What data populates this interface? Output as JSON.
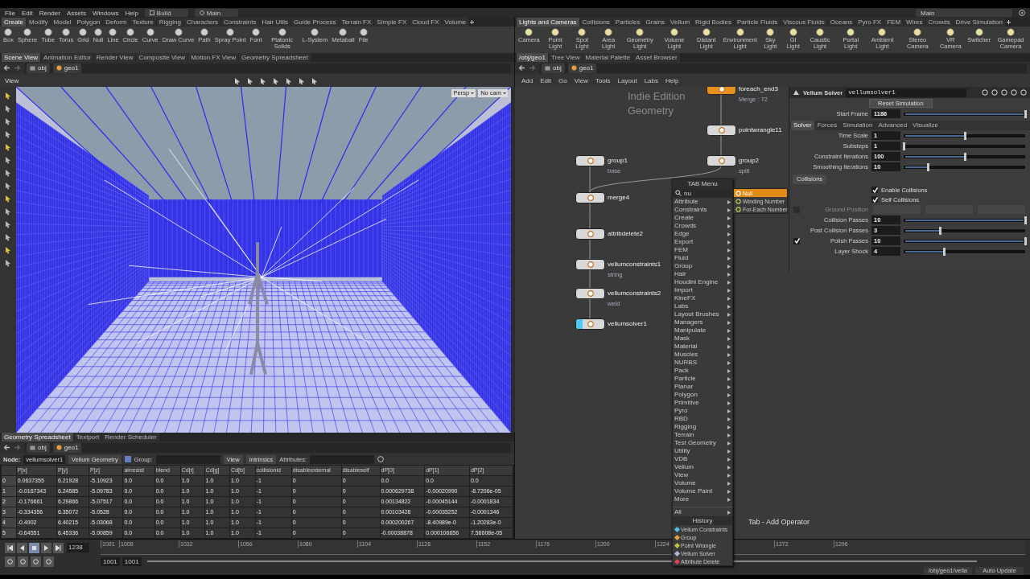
{
  "menubar": {
    "items": [
      "File",
      "Edit",
      "Render",
      "Assets",
      "Windows",
      "Help"
    ],
    "desktop": "Build",
    "context": "Main",
    "right_desktop": "Main"
  },
  "shelf_left": {
    "tabs": [
      {
        "label": "Create",
        "selected": true
      },
      {
        "label": "Modify",
        "selected": false
      },
      {
        "label": "Model",
        "selected": false
      },
      {
        "label": "Polygon",
        "selected": false
      },
      {
        "label": "Deform",
        "selected": false
      },
      {
        "label": "Texture",
        "selected": false
      },
      {
        "label": "Rigging",
        "selected": false
      },
      {
        "label": "Characters",
        "selected": false
      },
      {
        "label": "Constraints",
        "selected": false
      },
      {
        "label": "Hair Utils",
        "selected": false
      },
      {
        "label": "Guide Process",
        "selected": false
      },
      {
        "label": "Terrain FX",
        "selected": false
      },
      {
        "label": "Simple FX",
        "selected": false
      },
      {
        "label": "Cloud FX",
        "selected": false
      },
      {
        "label": "Volume",
        "selected": false
      }
    ],
    "tools": [
      "Box",
      "Sphere",
      "Tube",
      "Torus",
      "Grid",
      "Null",
      "Line",
      "Circle",
      "Curve",
      "Draw Curve",
      "Path",
      "Spray Point",
      "Font",
      "Platonic Solids",
      "L-System",
      "Metaball",
      "File"
    ]
  },
  "shelf_right": {
    "tabs": [
      {
        "label": "Lights and Cameras",
        "selected": true
      },
      {
        "label": "Collisions",
        "selected": false
      },
      {
        "label": "Particles",
        "selected": false
      },
      {
        "label": "Grains",
        "selected": false
      },
      {
        "label": "Vellum",
        "selected": false
      },
      {
        "label": "Rigid Bodies",
        "selected": false
      },
      {
        "label": "Particle Fluids",
        "selected": false
      },
      {
        "label": "Viscous Fluids",
        "selected": false
      },
      {
        "label": "Oceans",
        "selected": false
      },
      {
        "label": "Pyro FX",
        "selected": false
      },
      {
        "label": "FEM",
        "selected": false
      },
      {
        "label": "Wires",
        "selected": false
      },
      {
        "label": "Crowds",
        "selected": false
      },
      {
        "label": "Drive Simulation",
        "selected": false
      }
    ],
    "tools": [
      "Camera",
      "Point Light",
      "Spot Light",
      "Area Light",
      "Geometry Light",
      "Volume Light",
      "Distant Light",
      "Environment Light",
      "Sky Light",
      "GI Light",
      "Caustic Light",
      "Portal Light",
      "Ambient Light",
      "Stereo Camera",
      "VR Camera",
      "Switcher",
      "Gamepad Camera"
    ]
  },
  "left_pane": {
    "tabs": [
      {
        "label": "Scene View",
        "selected": true
      },
      {
        "label": "Animation Editor",
        "selected": false
      },
      {
        "label": "Render View",
        "selected": false
      },
      {
        "label": "Composite View",
        "selected": false
      },
      {
        "label": "Motion FX View",
        "selected": false
      },
      {
        "label": "Geometry Spreadsheet",
        "selected": false
      }
    ],
    "path": [
      "obj",
      "geo1"
    ],
    "view_label": "View",
    "camera": "Persp",
    "cam_menu": "No cam"
  },
  "spreadsheet": {
    "tabs": [
      {
        "label": "Geometry Spreadsheet",
        "selected": true
      },
      {
        "label": "Textport",
        "selected": false
      },
      {
        "label": "Render Scheduler",
        "selected": false
      }
    ],
    "path": [
      "obj",
      "geo1"
    ],
    "node_label": "Node:",
    "node": "vellumsolver1",
    "geometry_menu": "Vellum Geometry",
    "group_label": "Group:",
    "view_menu": "View",
    "intrinsics": "Intrinsics",
    "attributes_label": "Attributes:",
    "columns": [
      "",
      "P[x]",
      "P[y]",
      "P[z]",
      "airresist",
      "blend",
      "Cd[r]",
      "Cd[g]",
      "Cd[b]",
      "collisionid",
      "disableexternal",
      "disableself",
      "dP[0]",
      "dP[1]",
      "dP[2]"
    ],
    "rows": [
      [
        "0",
        "0.0637355",
        "6.21928",
        "-5.10923",
        "0.0",
        "0.0",
        "1.0",
        "1.0",
        "1.0",
        "-1",
        "0",
        "0",
        "0.0",
        "0.0",
        "0.0"
      ],
      [
        "1",
        "-0.0167343",
        "6.24585",
        "-5.09783",
        "0.0",
        "0.0",
        "1.0",
        "1.0",
        "1.0",
        "-1",
        "0",
        "0",
        "0.000629738",
        "-0.00020990",
        "-8.7206e-05"
      ],
      [
        "2",
        "-0.176661",
        "6.29866",
        "-5.07517",
        "0.0",
        "0.0",
        "1.0",
        "1.0",
        "1.0",
        "-1",
        "0",
        "0",
        "0.00134822",
        "-0.00045144",
        "-0.0001834"
      ],
      [
        "3",
        "-0.334356",
        "6.35072",
        "-5.0528",
        "0.0",
        "0.0",
        "1.0",
        "1.0",
        "1.0",
        "-1",
        "0",
        "0",
        "0.00103428",
        "-0.00035252",
        "-0.0001346"
      ],
      [
        "4",
        "-0.4902",
        "6.40215",
        "-5.03068",
        "0.0",
        "0.0",
        "1.0",
        "1.0",
        "1.0",
        "-1",
        "0",
        "0",
        "0.000200267",
        "-8.40989e-0",
        "-1.20283e-0"
      ],
      [
        "5",
        "-0.64551",
        "6.45336",
        "-5.00859",
        "0.0",
        "0.0",
        "1.0",
        "1.0",
        "1.0",
        "-1",
        "0",
        "0",
        "-0.00038878",
        "0.000106656",
        "7.56608e-05"
      ]
    ]
  },
  "right_pane": {
    "tabs": [
      {
        "label": "/obj/geo1",
        "selected": true
      },
      {
        "label": "Tree View",
        "selected": false
      },
      {
        "label": "Material Palette",
        "selected": false
      },
      {
        "label": "Asset Browser",
        "selected": false
      }
    ],
    "path": [
      "obj",
      "geo1"
    ],
    "menu": [
      "Add",
      "Edit",
      "Go",
      "View",
      "Tools",
      "Layout",
      "Labs",
      "Help"
    ],
    "network": {
      "edition_label": "Indie Edition",
      "context_label": "Geometry",
      "hint": "Tab - Add Operator",
      "nodes": [
        {
          "name": "foreach_end3",
          "comment": "Merge : 72",
          "color": "#e8901e",
          "display": false
        },
        {
          "name": "pointwrangle11",
          "color": "#d8d8d8",
          "display": false
        },
        {
          "name": "group1",
          "comment": "base",
          "color": "#d8d8d8",
          "display": false
        },
        {
          "name": "group2",
          "comment": "split",
          "color": "#d8d8d8",
          "display": false
        },
        {
          "name": "merge4",
          "color": "#d8d8d8",
          "display": false
        },
        {
          "name": "attribdelete2",
          "color": "#d8d8d8",
          "display": false
        },
        {
          "name": "vellumconstraints1",
          "comment": "string",
          "color": "#d8d8d8",
          "display": false
        },
        {
          "name": "vellumconstraints2",
          "comment": "weld",
          "color": "#d8d8d8",
          "display": false
        },
        {
          "name": "vellumsolver1",
          "color": "#d8d8d8",
          "display": true
        }
      ]
    },
    "parameters": {
      "type_label": "Vellum Solver",
      "node_name": "vellumsolver1",
      "reset_button": "Reset Simulation",
      "start_frame": {
        "label": "Start Frame",
        "value": "1186",
        "level": 1
      },
      "tabs": [
        {
          "label": "Solver",
          "selected": true
        },
        {
          "label": "Forces",
          "selected": false
        },
        {
          "label": "Simulation",
          "selected": false
        },
        {
          "label": "Advanced",
          "selected": false
        },
        {
          "label": "Visualize",
          "selected": false
        }
      ],
      "solver_rows": [
        {
          "label": "Time Scale",
          "value": "1",
          "level": 0.5
        },
        {
          "label": "Substeps",
          "value": "1",
          "level": 0
        },
        {
          "label": "Constraint Iterations",
          "value": "100",
          "level": 0.5
        },
        {
          "label": "Smoothing Iterations",
          "value": "10",
          "level": 0.2
        }
      ],
      "subtab": {
        "label": "Collisions",
        "selected": true
      },
      "collision_rows": [
        {
          "kind": "checkbox",
          "label": "Enable Collisions",
          "checked": true
        },
        {
          "kind": "checkbox",
          "label": "Self Collisions",
          "checked": true
        },
        {
          "kind": "vector",
          "label": "Ground Position",
          "checked": false,
          "disabled": true
        },
        {
          "kind": "slider",
          "label": "Collision Passes",
          "value": "10",
          "level": 1
        },
        {
          "kind": "slider",
          "label": "Post Collision Passes",
          "value": "3",
          "level": 0.3
        },
        {
          "kind": "toggled-slider",
          "label": "Polish Passes",
          "value": "10",
          "level": 1,
          "checked": true
        },
        {
          "kind": "slider",
          "label": "Layer Shock",
          "value": "4",
          "level": 0.33
        }
      ]
    }
  },
  "tab_menu": {
    "title": "TAB Menu",
    "search": "nu",
    "categories": [
      "Attribute",
      "Constraints",
      "Create",
      "Crowds",
      "Edge",
      "Export",
      "FEM",
      "Fluid",
      "Group",
      "Hair",
      "Houdini Engine",
      "Import",
      "KineFX",
      "Labs",
      "Layout Brushes",
      "Managers",
      "Manipulate",
      "Mask",
      "Material",
      "Muscles",
      "NURBS",
      "Pack",
      "Particle",
      "Planar",
      "Polygon",
      "Primitive",
      "Pyro",
      "RBD",
      "Rigging",
      "Terrain",
      "Test Geometry",
      "Utility",
      "VDB",
      "Vellum",
      "View",
      "Volume",
      "Volume Paint",
      "More"
    ],
    "results": [
      {
        "label": "Null",
        "selected": true
      },
      {
        "label": "Winding Number",
        "selected": false
      },
      {
        "label": "For-Each Number",
        "selected": false
      }
    ],
    "all": "All",
    "history_title": "History",
    "history": [
      "Vellum Constraints",
      "Group",
      "Point Wrangle",
      "Vellum Solver",
      "Attribute Delete"
    ]
  },
  "timeline": {
    "frame": "1238",
    "ticks": [
      "1001",
      "1008",
      "1032",
      "1056",
      "1080",
      "1104",
      "1128",
      "1152",
      "1176",
      "1200",
      "1224",
      "1272",
      "1296"
    ],
    "start": "1001",
    "end": "1001",
    "path": "/obj/geo1/vella",
    "update_mode": "Auto Update"
  }
}
